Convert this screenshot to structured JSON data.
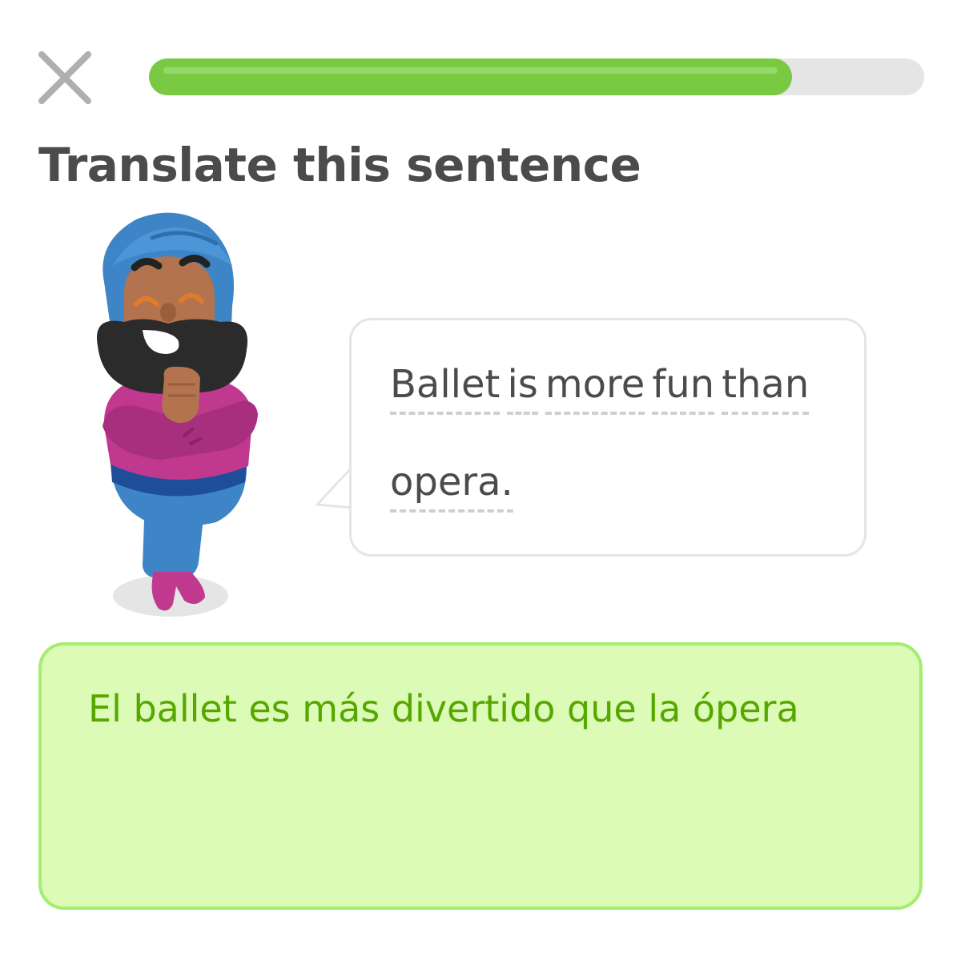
{
  "header": {
    "close_icon": "close-x-icon",
    "progress": {
      "fraction": 0.83,
      "fill_color": "#7ac943",
      "track_color": "#e5e5e5"
    }
  },
  "instruction": "Translate this sentence",
  "prompt": {
    "words": [
      "Ballet",
      "is",
      "more",
      "fun",
      "than",
      "opera."
    ]
  },
  "character": {
    "icon": "turban-man-character"
  },
  "answer": {
    "value": "El ballet es más divertido que la ópera",
    "text_color": "#58a700",
    "background": "#dcfbb7",
    "border": "#a5ed6e"
  }
}
